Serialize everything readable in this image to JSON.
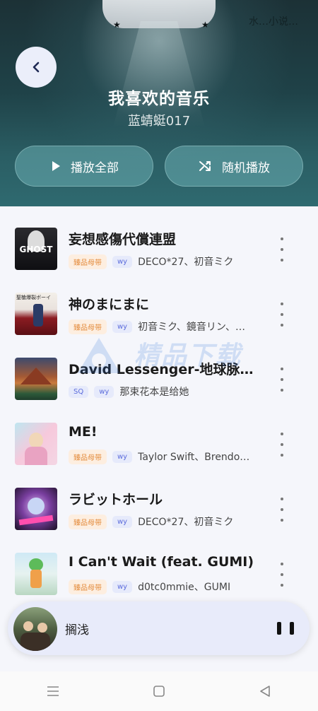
{
  "header": {
    "title": "我喜欢的音乐",
    "subtitle": "蓝蜻蜓017",
    "play_all_label": "播放全部",
    "shuffle_label": "随机播放",
    "overlay_text": "水…小说…"
  },
  "songs": [
    {
      "title": "妄想感傷代償連盟",
      "quality": "臻品母带",
      "source": "wy",
      "artist": "DECO*27、初音ミク",
      "cover_text": "GHOST"
    },
    {
      "title": "神のまにまに",
      "quality": "臻品母带",
      "source": "wy",
      "artist": "初音ミク、鏡音リン、…",
      "cover_text": "聖槍爆裂ボーイ"
    },
    {
      "title": "David Lessenger-地球脉动…",
      "quality": "SQ",
      "source": "wy",
      "artist": "那束花本是给她"
    },
    {
      "title": "ME!",
      "quality": "臻品母带",
      "source": "wy",
      "artist": "Taylor Swift、Brendo…"
    },
    {
      "title": "ラビットホール",
      "quality": "臻品母带",
      "source": "wy",
      "artist": "DECO*27、初音ミク"
    },
    {
      "title": "I Can't Wait (feat. GUMI)",
      "quality": "臻品母带",
      "source": "wy",
      "artist": "d0tc0mmie、GUMI"
    }
  ],
  "watermark": {
    "text": "精品下载"
  },
  "player": {
    "title": "搁浅"
  },
  "colors": {
    "accent": "#5c6cdc",
    "header_bg": "#1f4248",
    "quality_tag": "#e38a3a"
  }
}
